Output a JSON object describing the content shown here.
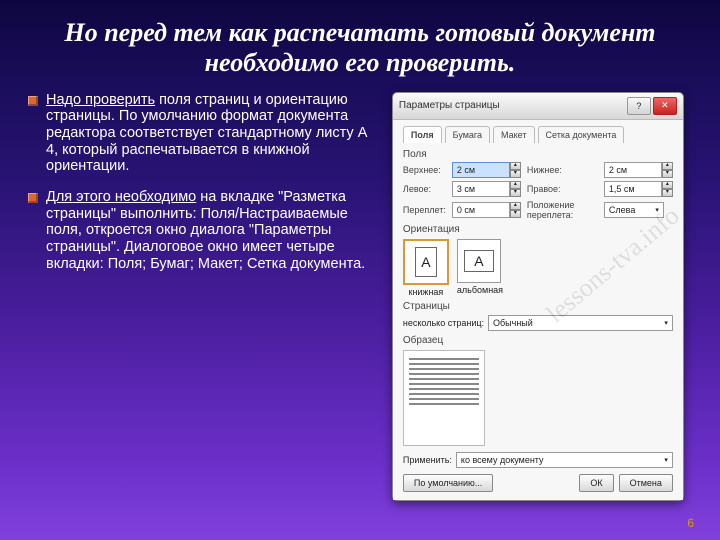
{
  "title": "Но перед тем как распечатать готовый документ необходимо его проверить.",
  "paragraphs": {
    "p1_lead": "Надо проверить",
    "p1_rest": " поля страниц и ориентацию страницы. По умолчанию формат документа редактора соответствует стандартному листу  А 4, который распечатывается в книжной ориентации.",
    "p2_lead": "Для этого необходимо",
    "p2_rest": " на вкладке \"Разметка страницы\" выполнить: Поля/Настраиваемые поля, откроется окно диалога \"Параметры страницы\". Диалоговое окно имеет четыре вкладки: Поля; Бумаг; Макет; Сетка документа."
  },
  "dialog": {
    "title": "Параметры страницы",
    "tabs": [
      "Поля",
      "Бумага",
      "Макет",
      "Сетка документа"
    ],
    "fields": {
      "section_margins": "Поля",
      "top": "Верхнее:",
      "top_v": "2 см",
      "bottom": "Нижнее:",
      "bottom_v": "2 см",
      "left": "Левое:",
      "left_v": "3 см",
      "right": "Правое:",
      "right_v": "1,5 см",
      "gutter": "Переплет:",
      "gutter_v": "0 см",
      "gutterpos": "Положение переплета:",
      "gutterpos_v": "Слева"
    },
    "orientation": {
      "label": "Ориентация",
      "portrait": "книжная",
      "landscape": "альбомная",
      "glyph": "A"
    },
    "pages": {
      "label": "Страницы",
      "multi": "несколько страниц:",
      "value": "Обычный"
    },
    "preview": "Образец",
    "apply": {
      "label": "Применить:",
      "value": "ко всему документу"
    },
    "buttons": {
      "default": "По умолчанию...",
      "ok": "ОК",
      "cancel": "Отмена"
    }
  },
  "watermark": "lessons-tva.info",
  "page_number": "6"
}
